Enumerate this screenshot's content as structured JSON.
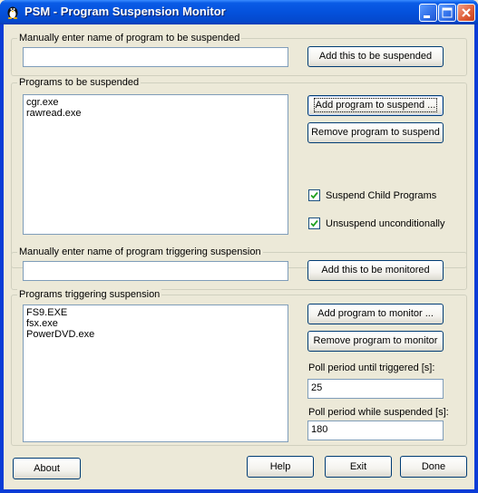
{
  "window": {
    "title": "PSM - Program Suspension Monitor"
  },
  "manual_suspend": {
    "group_label": "Manually enter name of program to be suspended",
    "input_value": "",
    "add_button": "Add this to be suspended"
  },
  "suspend_list": {
    "group_label": "Programs to be suspended",
    "items": [
      "cgr.exe",
      "rawread.exe"
    ],
    "add_button": "Add program to suspend ...",
    "remove_button": "Remove program to suspend",
    "suspend_child_label": "Suspend Child Programs",
    "suspend_child_checked": true,
    "unsuspend_label": "Unsuspend unconditionally",
    "unsuspend_checked": true
  },
  "manual_trigger": {
    "group_label": "Manually enter name of program triggering suspension",
    "input_value": "",
    "add_button": "Add this to be monitored"
  },
  "trigger_list": {
    "group_label": "Programs triggering suspension",
    "items": [
      "FS9.EXE",
      "fsx.exe",
      "PowerDVD.exe"
    ],
    "add_button": "Add program to monitor ...",
    "remove_button": "Remove program to monitor",
    "poll_triggered_label": "Poll period until triggered [s]:",
    "poll_triggered_value": "25",
    "poll_suspended_label": "Poll period while suspended [s]:",
    "poll_suspended_value": "180"
  },
  "footer": {
    "about": "About",
    "help": "Help",
    "exit": "Exit",
    "done": "Done"
  }
}
